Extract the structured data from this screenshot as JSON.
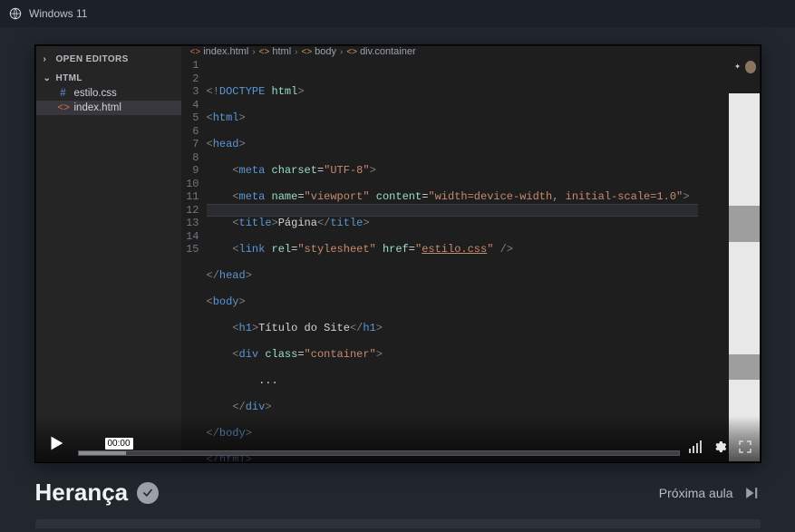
{
  "topbar": {
    "title": "Windows 11"
  },
  "vscode": {
    "sidebar": {
      "open_editors_label": "OPEN EDITORS",
      "project_label": "HTML",
      "files": [
        {
          "icon": "#",
          "icon_class": "css-icon",
          "name": "estilo.css"
        },
        {
          "icon": "<>",
          "icon_class": "html-icon",
          "name": "index.html"
        }
      ]
    },
    "breadcrumb": [
      {
        "icon": "<>",
        "label": "index.html"
      },
      {
        "icon": "",
        "label": "html"
      },
      {
        "icon": "",
        "label": "body"
      },
      {
        "icon": "",
        "label": "div.container"
      }
    ],
    "gutter": [
      "1",
      "2",
      "3",
      "4",
      "5",
      "6",
      "7",
      "8",
      "9",
      "10",
      "11",
      "12",
      "13",
      "14",
      "15"
    ]
  },
  "video": {
    "time": "00:00"
  },
  "lesson": {
    "title": "Herança",
    "next_label": "Próxima aula"
  }
}
